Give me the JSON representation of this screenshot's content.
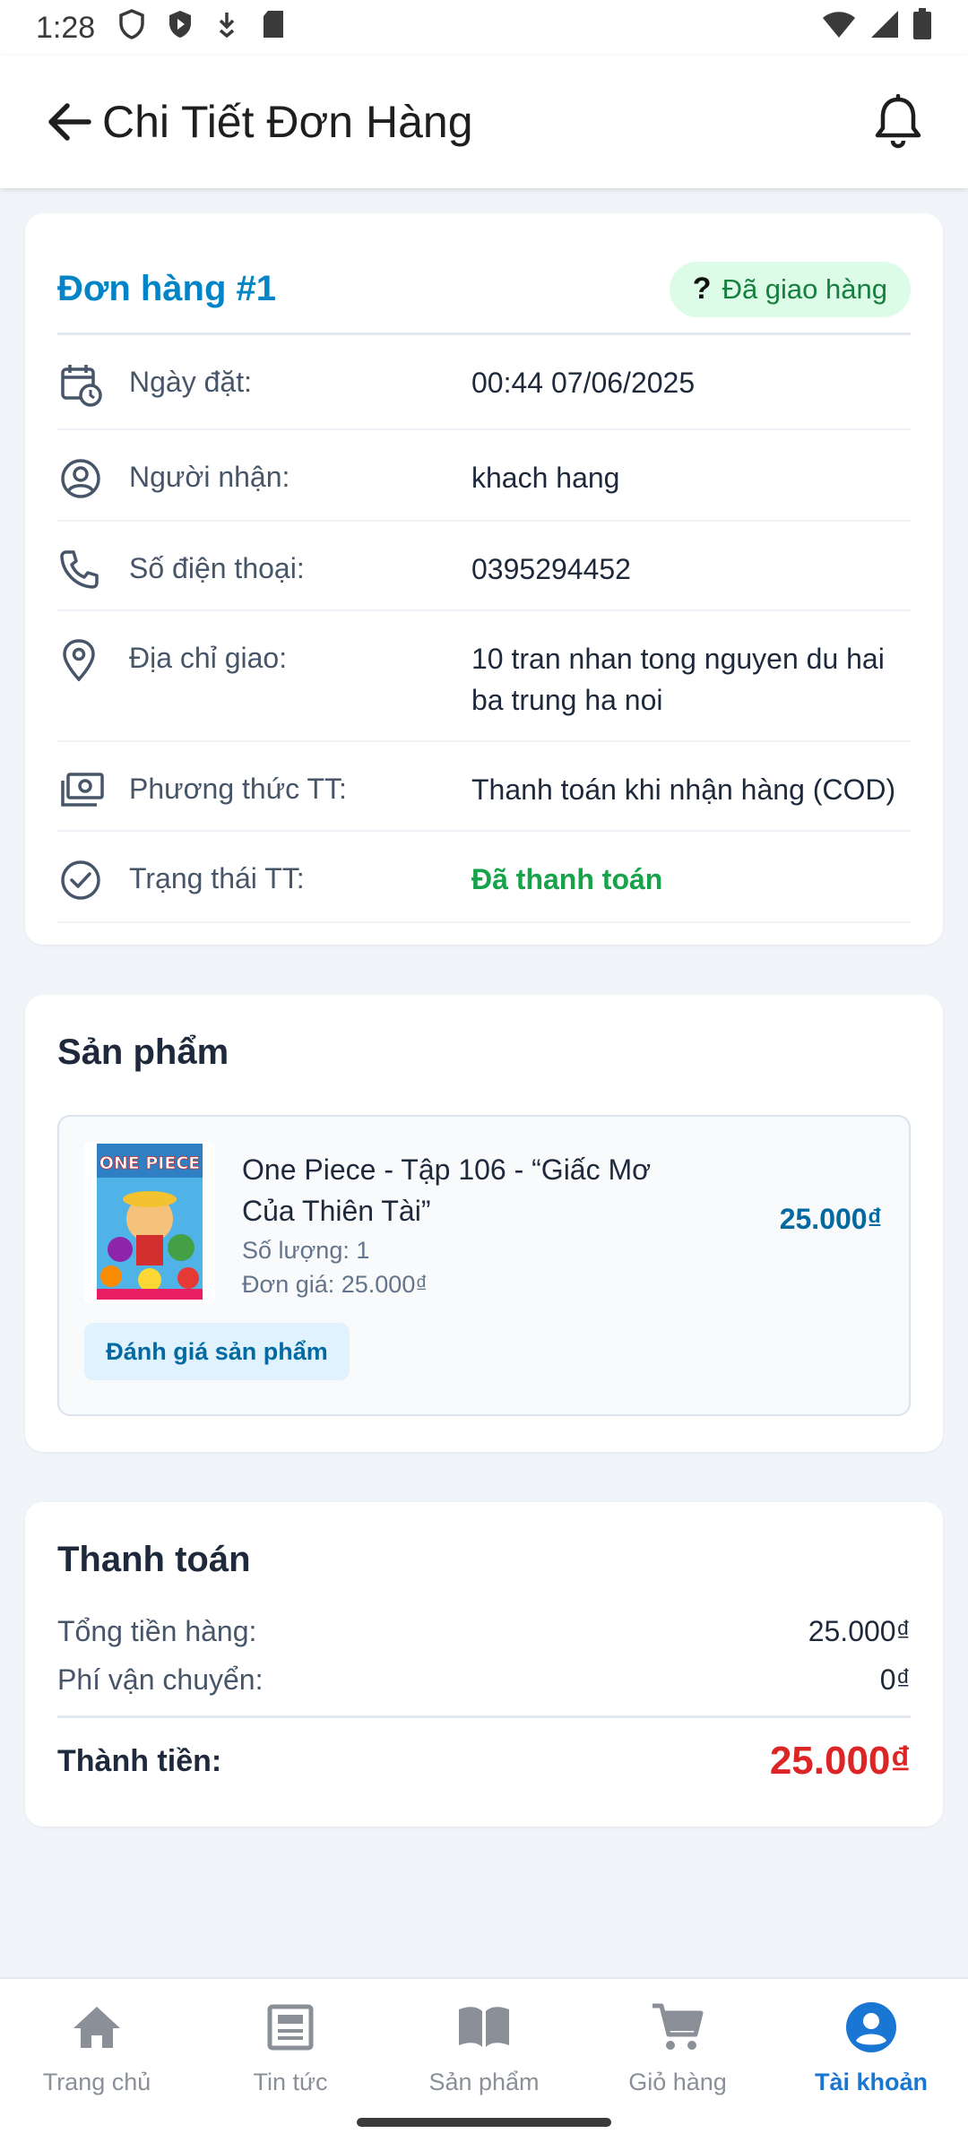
{
  "status_bar": {
    "time": "1:28"
  },
  "app_bar": {
    "title": "Chi Tiết Đơn Hàng"
  },
  "order": {
    "id_label": "Đơn hàng #1",
    "status_icon": "?",
    "status_label": "Đã giao hàng",
    "rows": [
      {
        "icon": "calendar-clock-icon",
        "label": "Ngày đặt:",
        "value": "00:44 07/06/2025"
      },
      {
        "icon": "user-circle-icon",
        "label": "Người nhận:",
        "value": "khach hang"
      },
      {
        "icon": "phone-icon",
        "label": "Số điện thoại:",
        "value": "0395294452"
      },
      {
        "icon": "location-pin-icon",
        "label": "Địa chỉ giao:",
        "value": "10 tran nhan tong nguyen du hai ba trung ha noi"
      },
      {
        "icon": "money-icon",
        "label": "Phương thức TT:",
        "value": "Thanh toán khi nhận hàng (COD)"
      },
      {
        "icon": "check-circle-icon",
        "label": "Trạng thái TT:",
        "value": "Đã thanh toán"
      }
    ]
  },
  "products": {
    "title": "Sản phẩm",
    "items": [
      {
        "name": "One Piece - Tập 106 - “Giấc Mơ Của Thiên Tài”",
        "quantity": "Số lượng: 1",
        "unit_price": "Đơn giá: 25.000₫",
        "price": "25.000₫",
        "review_button": "Đánh giá sản phẩm",
        "cover_title": "ONE PIECE"
      }
    ]
  },
  "payment": {
    "title": "Thanh toán",
    "subtotal_label": "Tổng tiền hàng:",
    "subtotal_value": "25.000₫",
    "shipping_label": "Phí vận chuyển:",
    "shipping_value": "0₫",
    "total_label": "Thành tiền:",
    "total_value": "25.000₫"
  },
  "bottom_nav": [
    {
      "icon": "home-icon",
      "label": "Trang chủ",
      "active": false
    },
    {
      "icon": "news-icon",
      "label": "Tin tức",
      "active": false
    },
    {
      "icon": "book-icon",
      "label": "Sản phẩm",
      "active": false
    },
    {
      "icon": "cart-icon",
      "label": "Giỏ hàng",
      "active": false
    },
    {
      "icon": "account-icon",
      "label": "Tài khoản",
      "active": true
    }
  ],
  "colors": {
    "accent": "#0284c7",
    "status_green": "#16a34a",
    "total_red": "#dc2626",
    "nav_active": "#1976d2"
  }
}
